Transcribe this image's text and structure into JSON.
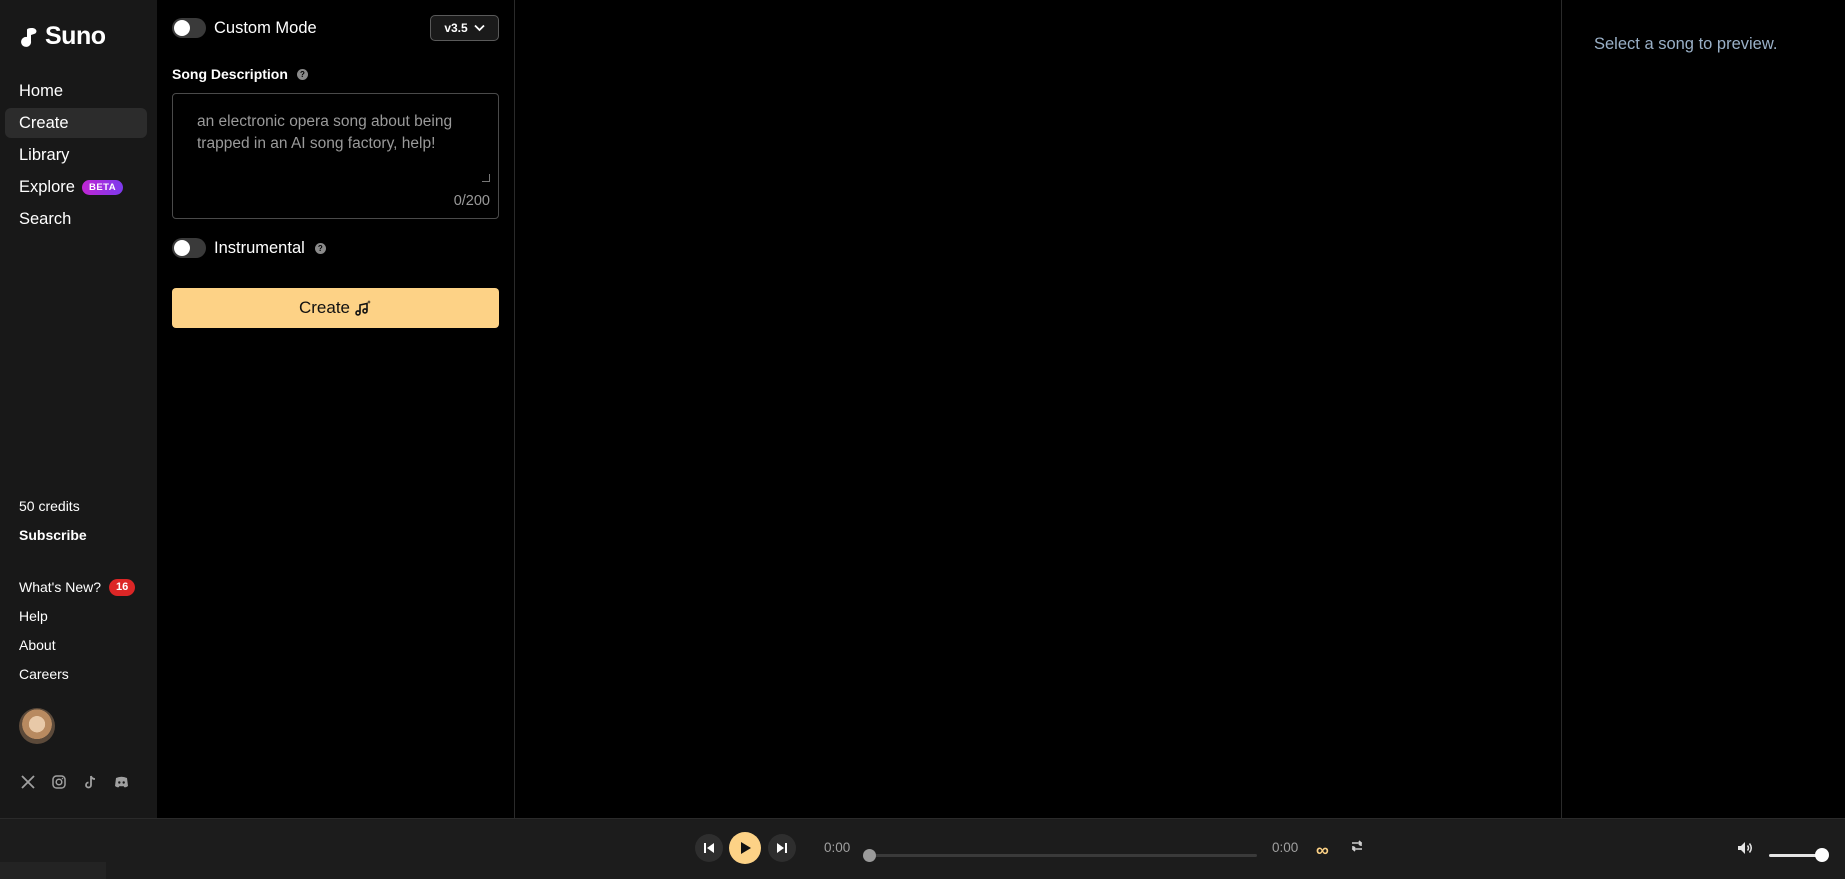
{
  "app": {
    "name": "Suno"
  },
  "sidebar": {
    "nav": [
      {
        "label": "Home"
      },
      {
        "label": "Create",
        "active": true
      },
      {
        "label": "Library"
      },
      {
        "label": "Explore",
        "badge": "BETA"
      },
      {
        "label": "Search"
      }
    ],
    "credits": "50 credits",
    "subscribe": "Subscribe",
    "whats_new": "What's New?",
    "whats_new_count": "16",
    "help": "Help",
    "about": "About",
    "careers": "Careers",
    "socials": [
      "x-icon",
      "instagram-icon",
      "tiktok-icon",
      "discord-icon"
    ]
  },
  "create": {
    "custom_mode_label": "Custom Mode",
    "custom_mode_on": false,
    "version": "v3.5",
    "song_description_label": "Song Description",
    "description_placeholder": "an electronic opera song about being trapped in an AI song factory, help!",
    "char_count": "0/200",
    "instrumental_label": "Instrumental",
    "instrumental_on": false,
    "create_button": "Create"
  },
  "preview": {
    "empty_text": "Select a song to preview."
  },
  "player": {
    "current_time": "0:00",
    "duration": "0:00",
    "progress": 0,
    "volume": 0.9
  },
  "colors": {
    "accent": "#fdd286",
    "sidebar_bg": "#181818",
    "badge_red": "#dc2626",
    "beta_gradient_start": "#c026d3",
    "beta_gradient_end": "#7c3aed"
  }
}
